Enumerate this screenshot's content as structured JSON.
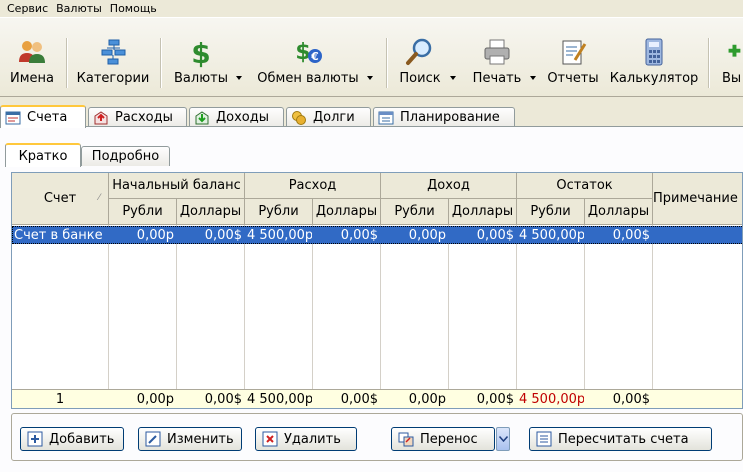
{
  "menu": [
    "Сервис",
    "Валюты",
    "Помощь"
  ],
  "toolbar": {
    "names": "Имена",
    "categories": "Категории",
    "currencies": "Валюты",
    "exchange": "Обмен валюты",
    "search": "Поиск",
    "print": "Печать",
    "reports": "Отчеты",
    "calculator": "Калькулятор",
    "exit": "Вы"
  },
  "main_tabs": [
    "Счета",
    "Расходы",
    "Доходы",
    "Долги",
    "Планирование"
  ],
  "sub_tabs": [
    "Кратко",
    "Подробно"
  ],
  "grid": {
    "col_account": "Счет",
    "groups": [
      "Начальный баланс",
      "Расход",
      "Доход",
      "Остаток"
    ],
    "col_note": "Примечание",
    "sub": {
      "rub": "Рубли",
      "usd": "Доллары"
    },
    "row": {
      "account": "Счет в банке",
      "values": [
        "0,00р",
        "0,00$",
        "4 500,00р",
        "0,00$",
        "0,00р",
        "0,00$",
        "4 500,00р",
        "0,00$"
      ]
    },
    "footer": {
      "count": "1",
      "values": [
        "0,00р",
        "0,00$",
        "4 500,00р",
        "0,00$",
        "0,00р",
        "0,00$",
        "4 500,00р",
        "0,00$"
      ]
    }
  },
  "buttons": {
    "add": "Добавить",
    "edit": "Изменить",
    "delete": "Удалить",
    "transfer": "Перенос",
    "recalc": "Пересчитать счета"
  },
  "colors": {
    "selection": "#316ac5",
    "footer_bg": "#ffffe1",
    "negative_red": "#c00000",
    "tab_accent": "#ffc83c"
  }
}
